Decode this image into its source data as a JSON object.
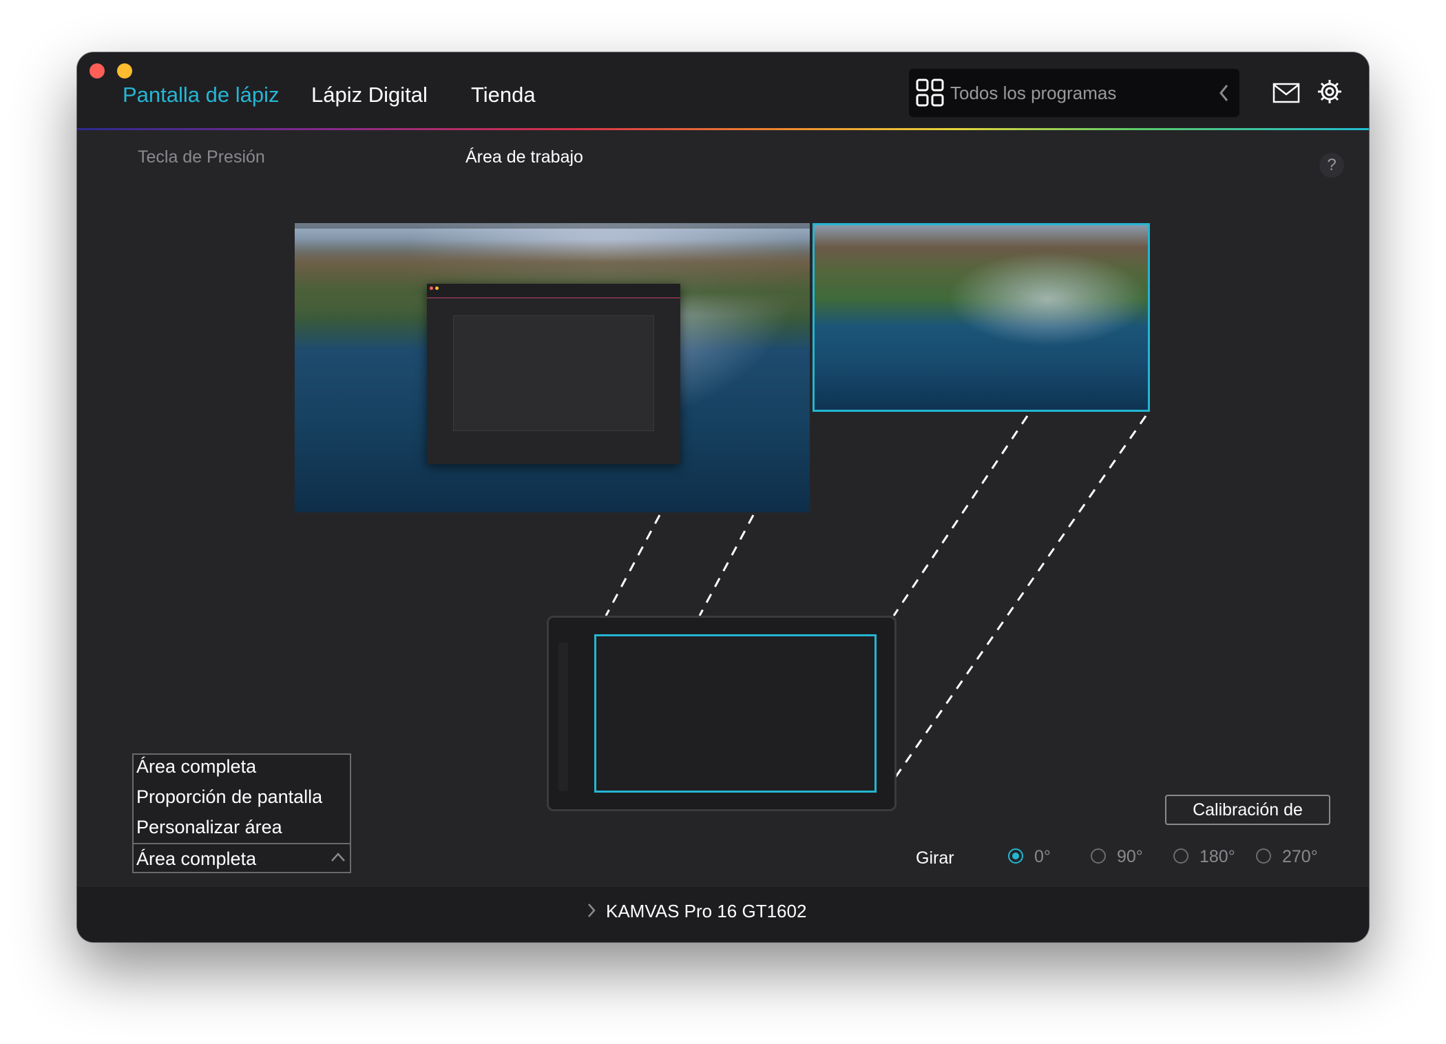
{
  "app": {
    "nav_tabs": [
      {
        "label": "Pantalla de lápiz",
        "active": true
      },
      {
        "label": "Lápiz Digital",
        "active": false
      },
      {
        "label": "Tienda",
        "active": false
      }
    ],
    "program_selector": {
      "label": "Todos los programas"
    },
    "icons": {
      "mail": "mail-icon",
      "settings": "gear-icon",
      "apps": "grid-icon",
      "help": "help-icon"
    }
  },
  "subtabs": [
    {
      "label": "Tecla de Presión",
      "active": false
    },
    {
      "label": "Área de trabajo",
      "active": true
    }
  ],
  "help_label": "?",
  "area_mode": {
    "options": [
      "Área completa",
      "Proporción de pantalla",
      "Personalizar área"
    ],
    "selected": "Área completa"
  },
  "calibration_button": "Calibración de",
  "rotate": {
    "label": "Girar",
    "options": [
      "0°",
      "90°",
      "180°",
      "270°"
    ],
    "selected": "0°"
  },
  "device": {
    "name": "KAMVAS Pro 16 GT1602"
  },
  "colors": {
    "accent": "#23b6d2",
    "window_bg": "#252528",
    "titlebar_bg": "#1f1f22"
  }
}
